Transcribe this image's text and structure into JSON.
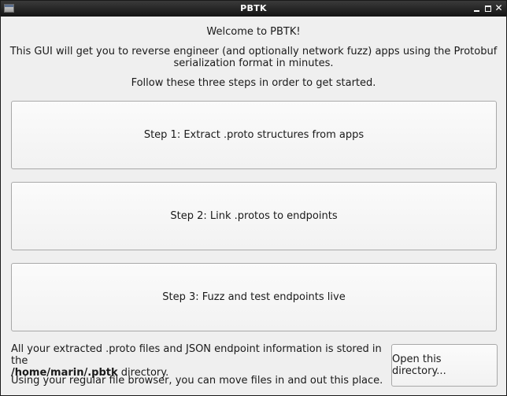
{
  "window": {
    "title": "PBTK"
  },
  "header": {
    "welcome": "Welcome to PBTK!",
    "intro_line1": "This GUI will get you to reverse engineer (and optionally network fuzz) apps using the Protobuf",
    "intro_line2": "serialization format in minutes.",
    "instructions": "Follow these three steps in order to get started."
  },
  "steps": [
    {
      "label": "Step 1: Extract .proto structures from apps"
    },
    {
      "label": "Step 2: Link .protos to endpoints"
    },
    {
      "label": "Step 3: Fuzz and test endpoints live"
    }
  ],
  "footer": {
    "storage_prefix": "All your extracted .proto files and JSON endpoint information is stored in the",
    "storage_path": "/home/marin/.pbtk",
    "storage_suffix": " directory.",
    "browser_note": "Using your regular file browser, you can move files in and out this place.",
    "open_button": "Open this directory..."
  },
  "icons": {
    "window_icon": "window-icon",
    "minimize": "minimize-icon",
    "maximize": "maximize-icon",
    "close": "close-icon"
  }
}
